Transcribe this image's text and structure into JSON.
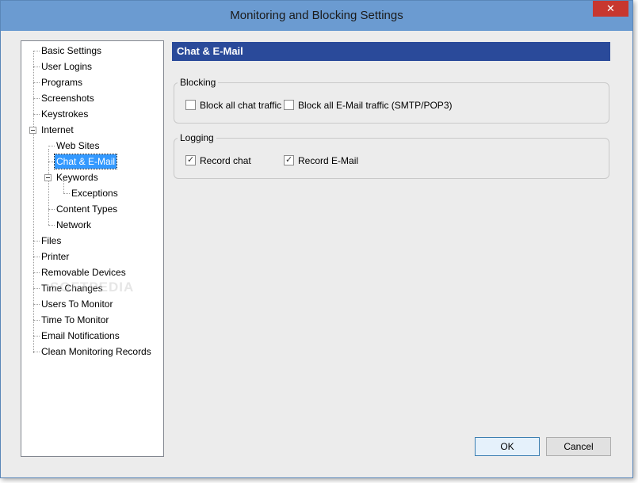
{
  "window": {
    "title": "Monitoring and Blocking Settings",
    "close_glyph": "✕"
  },
  "tree": {
    "items": [
      {
        "label": "Basic Settings"
      },
      {
        "label": "User Logins"
      },
      {
        "label": "Programs"
      },
      {
        "label": "Screenshots"
      },
      {
        "label": "Keystrokes"
      },
      {
        "label": "Internet"
      },
      {
        "label": "Web Sites"
      },
      {
        "label": "Chat & E-Mail"
      },
      {
        "label": "Keywords"
      },
      {
        "label": "Exceptions"
      },
      {
        "label": "Content Types"
      },
      {
        "label": "Network"
      },
      {
        "label": "Files"
      },
      {
        "label": "Printer"
      },
      {
        "label": "Removable Devices"
      },
      {
        "label": "Time Changes"
      },
      {
        "label": "Users To Monitor"
      },
      {
        "label": "Time To Monitor"
      },
      {
        "label": "Email Notifications"
      },
      {
        "label": "Clean Monitoring Records"
      }
    ],
    "selected": "Chat & E-Mail"
  },
  "panel": {
    "title": "Chat & E-Mail",
    "blocking": {
      "label": "Blocking",
      "block_chat": {
        "label": "Block all chat traffic",
        "checked": false
      },
      "block_email": {
        "label": "Block all E-Mail traffic (SMTP/POP3)",
        "checked": false
      }
    },
    "logging": {
      "label": "Logging",
      "record_chat": {
        "label": "Record chat",
        "checked": true
      },
      "record_email": {
        "label": "Record E-Mail",
        "checked": true
      }
    }
  },
  "buttons": {
    "ok": "OK",
    "cancel": "Cancel"
  },
  "watermark": "SOFTPEDIA",
  "colors": {
    "titlebar": "#6b9bd1",
    "header": "#2a4a9a",
    "selection": "#3399ff",
    "close": "#c7372f"
  }
}
